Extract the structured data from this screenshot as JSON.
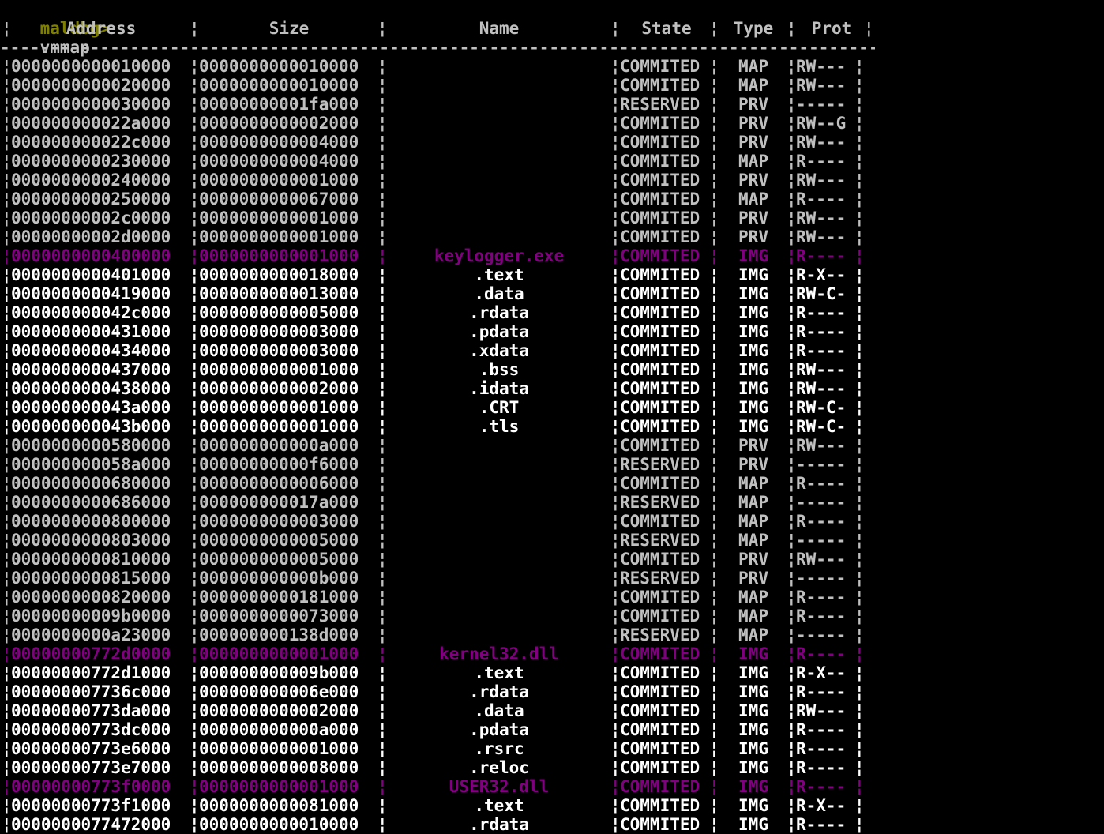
{
  "prompt": {
    "text": "maldbg>",
    "command": "vmmap"
  },
  "header": {
    "address": "Address",
    "size": "Size",
    "name": "Name",
    "state": "State",
    "type": "Type",
    "prot": "Prot"
  },
  "rule": "-----------------------------------------------------------------------------------------------",
  "separator": "¦",
  "colors": {
    "background": "#000000",
    "prompt": "#808000",
    "plain_text": "#c0c0c0",
    "section_text": "#ffffff",
    "module_text": "#800080"
  },
  "rows": [
    {
      "address": "0000000000010000",
      "size": "0000000000010000",
      "name": "",
      "state": "COMMITED",
      "type": "MAP",
      "prot": "RW---",
      "kind": "plain"
    },
    {
      "address": "0000000000020000",
      "size": "0000000000010000",
      "name": "",
      "state": "COMMITED",
      "type": "MAP",
      "prot": "RW---",
      "kind": "plain"
    },
    {
      "address": "0000000000030000",
      "size": "00000000001fa000",
      "name": "",
      "state": "RESERVED",
      "type": "PRV",
      "prot": "-----",
      "kind": "plain"
    },
    {
      "address": "000000000022a000",
      "size": "0000000000002000",
      "name": "",
      "state": "COMMITED",
      "type": "PRV",
      "prot": "RW--G",
      "kind": "plain"
    },
    {
      "address": "000000000022c000",
      "size": "0000000000004000",
      "name": "",
      "state": "COMMITED",
      "type": "PRV",
      "prot": "RW---",
      "kind": "plain"
    },
    {
      "address": "0000000000230000",
      "size": "0000000000004000",
      "name": "",
      "state": "COMMITED",
      "type": "MAP",
      "prot": "R----",
      "kind": "plain"
    },
    {
      "address": "0000000000240000",
      "size": "0000000000001000",
      "name": "",
      "state": "COMMITED",
      "type": "PRV",
      "prot": "RW---",
      "kind": "plain"
    },
    {
      "address": "0000000000250000",
      "size": "0000000000067000",
      "name": "",
      "state": "COMMITED",
      "type": "MAP",
      "prot": "R----",
      "kind": "plain"
    },
    {
      "address": "00000000002c0000",
      "size": "0000000000001000",
      "name": "",
      "state": "COMMITED",
      "type": "PRV",
      "prot": "RW---",
      "kind": "plain"
    },
    {
      "address": "00000000002d0000",
      "size": "0000000000001000",
      "name": "",
      "state": "COMMITED",
      "type": "PRV",
      "prot": "RW---",
      "kind": "plain"
    },
    {
      "address": "0000000000400000",
      "size": "0000000000001000",
      "name": "keylogger.exe",
      "state": "COMMITED",
      "type": "IMG",
      "prot": "R----",
      "kind": "module"
    },
    {
      "address": "0000000000401000",
      "size": "0000000000018000",
      "name": ".text",
      "state": "COMMITED",
      "type": "IMG",
      "prot": "R-X--",
      "kind": "section"
    },
    {
      "address": "0000000000419000",
      "size": "0000000000013000",
      "name": ".data",
      "state": "COMMITED",
      "type": "IMG",
      "prot": "RW-C-",
      "kind": "section"
    },
    {
      "address": "000000000042c000",
      "size": "0000000000005000",
      "name": ".rdata",
      "state": "COMMITED",
      "type": "IMG",
      "prot": "R----",
      "kind": "section"
    },
    {
      "address": "0000000000431000",
      "size": "0000000000003000",
      "name": ".pdata",
      "state": "COMMITED",
      "type": "IMG",
      "prot": "R----",
      "kind": "section"
    },
    {
      "address": "0000000000434000",
      "size": "0000000000003000",
      "name": ".xdata",
      "state": "COMMITED",
      "type": "IMG",
      "prot": "R----",
      "kind": "section"
    },
    {
      "address": "0000000000437000",
      "size": "0000000000001000",
      "name": ".bss",
      "state": "COMMITED",
      "type": "IMG",
      "prot": "RW---",
      "kind": "section"
    },
    {
      "address": "0000000000438000",
      "size": "0000000000002000",
      "name": ".idata",
      "state": "COMMITED",
      "type": "IMG",
      "prot": "RW---",
      "kind": "section"
    },
    {
      "address": "000000000043a000",
      "size": "0000000000001000",
      "name": ".CRT",
      "state": "COMMITED",
      "type": "IMG",
      "prot": "RW-C-",
      "kind": "section"
    },
    {
      "address": "000000000043b000",
      "size": "0000000000001000",
      "name": ".tls",
      "state": "COMMITED",
      "type": "IMG",
      "prot": "RW-C-",
      "kind": "section"
    },
    {
      "address": "0000000000580000",
      "size": "000000000000a000",
      "name": "",
      "state": "COMMITED",
      "type": "PRV",
      "prot": "RW---",
      "kind": "plain"
    },
    {
      "address": "000000000058a000",
      "size": "00000000000f6000",
      "name": "",
      "state": "RESERVED",
      "type": "PRV",
      "prot": "-----",
      "kind": "plain"
    },
    {
      "address": "0000000000680000",
      "size": "0000000000006000",
      "name": "",
      "state": "COMMITED",
      "type": "MAP",
      "prot": "R----",
      "kind": "plain"
    },
    {
      "address": "0000000000686000",
      "size": "000000000017a000",
      "name": "",
      "state": "RESERVED",
      "type": "MAP",
      "prot": "-----",
      "kind": "plain"
    },
    {
      "address": "0000000000800000",
      "size": "0000000000003000",
      "name": "",
      "state": "COMMITED",
      "type": "MAP",
      "prot": "R----",
      "kind": "plain"
    },
    {
      "address": "0000000000803000",
      "size": "0000000000005000",
      "name": "",
      "state": "RESERVED",
      "type": "MAP",
      "prot": "-----",
      "kind": "plain"
    },
    {
      "address": "0000000000810000",
      "size": "0000000000005000",
      "name": "",
      "state": "COMMITED",
      "type": "PRV",
      "prot": "RW---",
      "kind": "plain"
    },
    {
      "address": "0000000000815000",
      "size": "000000000000b000",
      "name": "",
      "state": "RESERVED",
      "type": "PRV",
      "prot": "-----",
      "kind": "plain"
    },
    {
      "address": "0000000000820000",
      "size": "0000000000181000",
      "name": "",
      "state": "COMMITED",
      "type": "MAP",
      "prot": "R----",
      "kind": "plain"
    },
    {
      "address": "00000000009b0000",
      "size": "0000000000073000",
      "name": "",
      "state": "COMMITED",
      "type": "MAP",
      "prot": "R----",
      "kind": "plain"
    },
    {
      "address": "0000000000a23000",
      "size": "000000000138d000",
      "name": "",
      "state": "RESERVED",
      "type": "MAP",
      "prot": "-----",
      "kind": "plain"
    },
    {
      "address": "00000000772d0000",
      "size": "0000000000001000",
      "name": "kernel32.dll",
      "state": "COMMITED",
      "type": "IMG",
      "prot": "R----",
      "kind": "module"
    },
    {
      "address": "00000000772d1000",
      "size": "000000000009b000",
      "name": ".text",
      "state": "COMMITED",
      "type": "IMG",
      "prot": "R-X--",
      "kind": "section"
    },
    {
      "address": "000000007736c000",
      "size": "000000000006e000",
      "name": ".rdata",
      "state": "COMMITED",
      "type": "IMG",
      "prot": "R----",
      "kind": "section"
    },
    {
      "address": "00000000773da000",
      "size": "0000000000002000",
      "name": ".data",
      "state": "COMMITED",
      "type": "IMG",
      "prot": "RW---",
      "kind": "section"
    },
    {
      "address": "00000000773dc000",
      "size": "000000000000a000",
      "name": ".pdata",
      "state": "COMMITED",
      "type": "IMG",
      "prot": "R----",
      "kind": "section"
    },
    {
      "address": "00000000773e6000",
      "size": "0000000000001000",
      "name": ".rsrc",
      "state": "COMMITED",
      "type": "IMG",
      "prot": "R----",
      "kind": "section"
    },
    {
      "address": "00000000773e7000",
      "size": "0000000000008000",
      "name": ".reloc",
      "state": "COMMITED",
      "type": "IMG",
      "prot": "R----",
      "kind": "section"
    },
    {
      "address": "00000000773f0000",
      "size": "0000000000001000",
      "name": "USER32.dll",
      "state": "COMMITED",
      "type": "IMG",
      "prot": "R----",
      "kind": "module"
    },
    {
      "address": "00000000773f1000",
      "size": "0000000000081000",
      "name": ".text",
      "state": "COMMITED",
      "type": "IMG",
      "prot": "R-X--",
      "kind": "section"
    },
    {
      "address": "0000000077472000",
      "size": "0000000000010000",
      "name": ".rdata",
      "state": "COMMITED",
      "type": "IMG",
      "prot": "R----",
      "kind": "section"
    }
  ]
}
